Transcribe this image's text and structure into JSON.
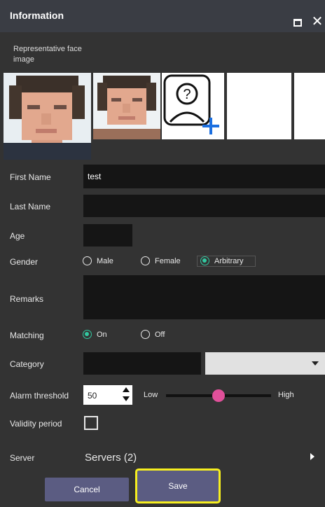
{
  "window": {
    "title": "Information"
  },
  "face_section": {
    "label": "Representative face image"
  },
  "form": {
    "first_name": {
      "label": "First Name",
      "value": "test"
    },
    "last_name": {
      "label": "Last Name",
      "value": ""
    },
    "age": {
      "label": "Age",
      "value": ""
    },
    "gender": {
      "label": "Gender",
      "options": [
        "Male",
        "Female",
        "Arbitrary"
      ],
      "selected": "Arbitrary"
    },
    "remarks": {
      "label": "Remarks",
      "value": ""
    },
    "matching": {
      "label": "Matching",
      "options": [
        "On",
        "Off"
      ],
      "selected": "On"
    },
    "category": {
      "label": "Category",
      "value": "",
      "selected_option": ""
    },
    "alarm_threshold": {
      "label": "Alarm threshold",
      "value": "50",
      "low_label": "Low",
      "high_label": "High",
      "slider_fraction": 0.5
    },
    "validity_period": {
      "label": "Validity period",
      "checked": false
    },
    "server": {
      "label": "Server",
      "value": "Servers (2)"
    }
  },
  "buttons": {
    "cancel": "Cancel",
    "save": "Save"
  },
  "colors": {
    "accent_radio": "#32c8a0",
    "slider_thumb": "#e0509a",
    "button_bg": "#5b5c82",
    "highlight": "#f6ee1f",
    "add_plus": "#1b6fe0"
  },
  "icons": {
    "add_face": "unknown-person-add-icon",
    "maximize": "maximize-icon",
    "close": "close-icon"
  }
}
